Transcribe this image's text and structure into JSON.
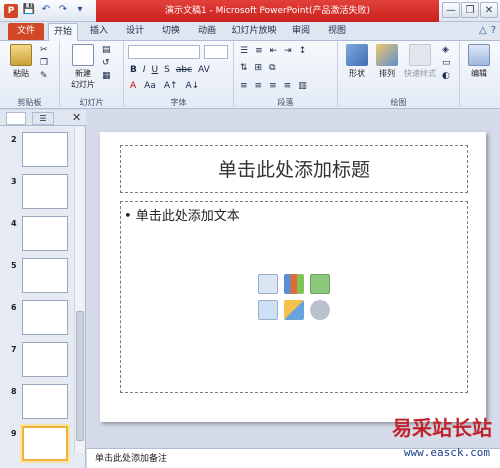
{
  "window": {
    "title": "演示文稿1 - Microsoft PowerPoint(产品激活失败)",
    "app_icon": "P",
    "controls": [
      "—",
      "❐",
      "✕"
    ]
  },
  "qat": [
    "💾",
    "↶",
    "↷",
    "▾"
  ],
  "tabs": {
    "file": "文件",
    "items": [
      "开始",
      "插入",
      "设计",
      "切换",
      "动画",
      "幻灯片放映",
      "审阅",
      "视图"
    ],
    "active": "开始"
  },
  "ribbon": {
    "clipboard": {
      "label": "剪贴板",
      "paste": "粘贴"
    },
    "slides": {
      "label": "幻灯片",
      "new_slide": "新建\n幻灯片"
    },
    "font": {
      "label": "字体",
      "buttons": [
        "B",
        "I",
        "U",
        "S",
        "abc",
        "AV"
      ]
    },
    "paragraph": {
      "label": "段落"
    },
    "drawing": {
      "label": "绘图",
      "shapes": "形状",
      "arrange": "排列",
      "quick_styles": "快速样式"
    },
    "editing": {
      "label": "编辑"
    }
  },
  "thumbnails": {
    "numbers": [
      "2",
      "3",
      "4",
      "5",
      "6",
      "7",
      "8",
      "9"
    ],
    "selected": "9"
  },
  "slide": {
    "title_placeholder": "单击此处添加标题",
    "body_placeholder": "• 单击此处添加文本"
  },
  "notes": "单击此处添加备注",
  "watermark": {
    "text": "易采站长站",
    "url": "www.easck.com"
  },
  "colors": {
    "file_tab": "#d24726",
    "title_highlight": "#c9211e",
    "selection": "#f3b03c"
  }
}
